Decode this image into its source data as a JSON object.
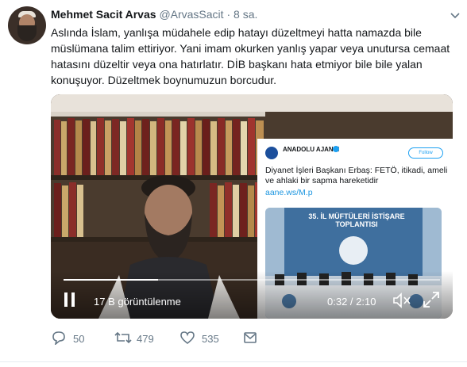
{
  "author": {
    "name": "Mehmet Sacit Arvas",
    "handle": "@ArvasSacit",
    "separator": "·",
    "time": "8 sa."
  },
  "tweet_text": "Aslında İslam, yanlışa müdahele edip hatayı düzeltmeyi hatta namazda bile müslümana talim ettiriyor. Yani imam okurken yanlış yapar veya unutursa cemaat hatasını düzeltir veya ona hatırlatır. DİB başkanı hata etmiyor bile bile yalan konuşuyor. Düzeltmek boynumuzun borcudur.",
  "embedded_card": {
    "account_name": "ANADOLU AJANSI",
    "follow_label": "Follow",
    "text": "Diyanet İşleri Başkanı Erbaş: FETÖ, itikadi, ameli ve ahlaki bir sapma hareketidir",
    "link": "aane.ws/M.p",
    "photo_title": "35. İL MÜFTÜLERİ İSTİŞARE TOPLANTISI"
  },
  "video": {
    "views": "17 B görüntülenme",
    "time": "0:32 / 2:10",
    "progress": 0.25
  },
  "actions": {
    "replies": "50",
    "retweets": "479",
    "likes": "535"
  },
  "colors": {
    "link": "#1b95e0",
    "muted": "#657786",
    "text": "#14171a"
  }
}
